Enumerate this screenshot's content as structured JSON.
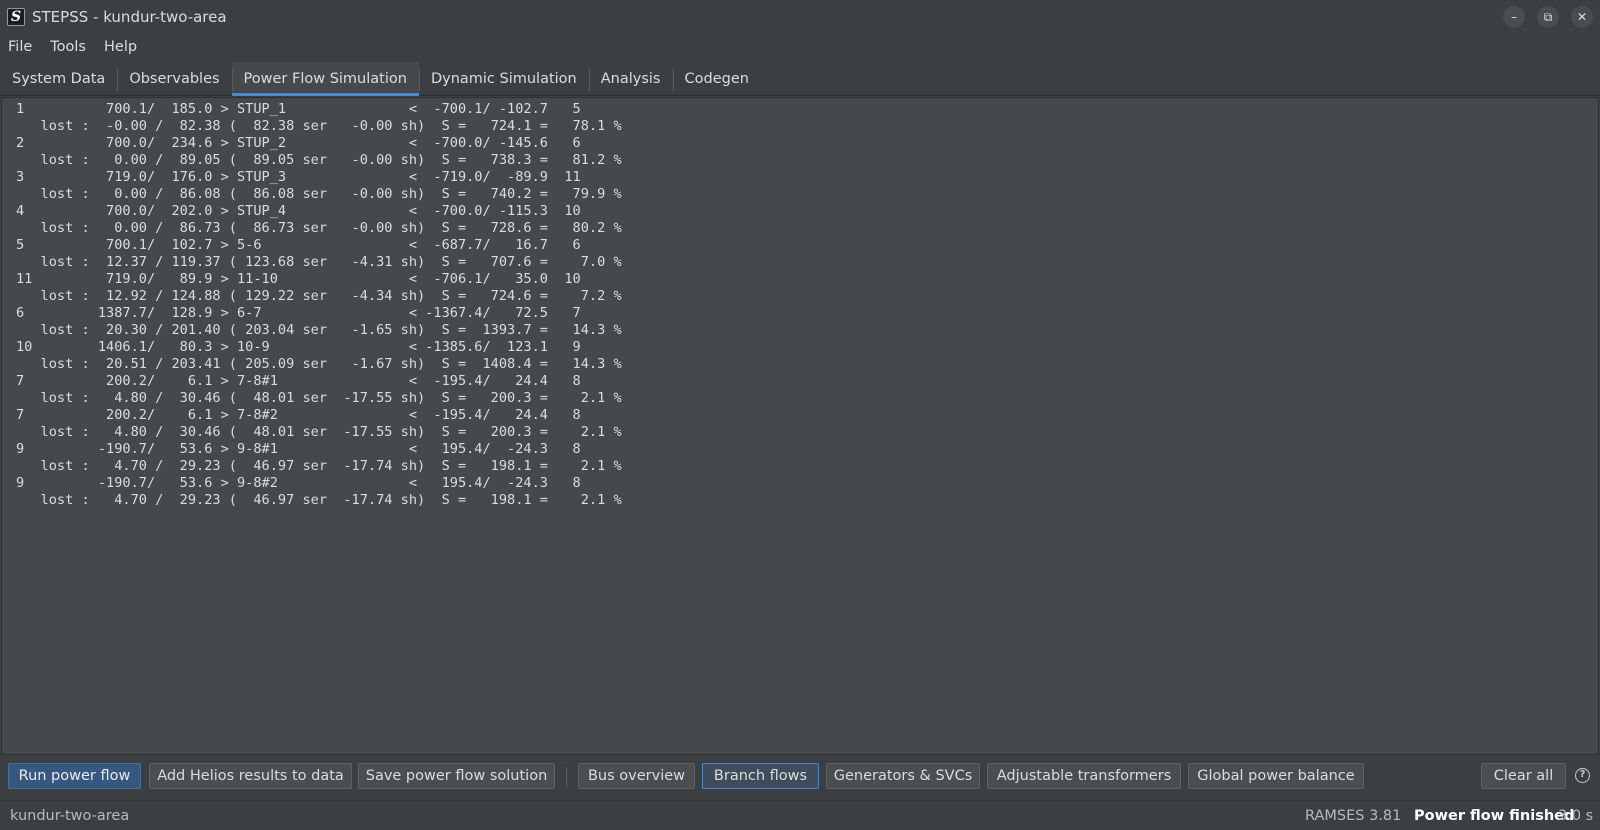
{
  "window": {
    "app_icon_letter": "S",
    "title": "STEPSS - kundur-two-area",
    "minimize_glyph": "–",
    "restore_glyph": "⧉",
    "close_glyph": "✕"
  },
  "menu": [
    "File",
    "Tools",
    "Help"
  ],
  "tabs": [
    {
      "label": "System Data",
      "active": false
    },
    {
      "label": "Observables",
      "active": false
    },
    {
      "label": "Power Flow Simulation",
      "active": true
    },
    {
      "label": "Dynamic Simulation",
      "active": false
    },
    {
      "label": "Analysis",
      "active": false
    },
    {
      "label": "Codegen",
      "active": false
    }
  ],
  "output_lines": [
    "1          700.1/  185.0 > STUP_1               <  -700.1/ -102.7   5",
    "   lost :  -0.00 /  82.38 (  82.38 ser   -0.00 sh)  S =   724.1 =   78.1 %",
    "2          700.0/  234.6 > STUP_2               <  -700.0/ -145.6   6",
    "   lost :   0.00 /  89.05 (  89.05 ser   -0.00 sh)  S =   738.3 =   81.2 %",
    "3          719.0/  176.0 > STUP_3               <  -719.0/  -89.9  11",
    "   lost :   0.00 /  86.08 (  86.08 ser   -0.00 sh)  S =   740.2 =   79.9 %",
    "4          700.0/  202.0 > STUP_4               <  -700.0/ -115.3  10",
    "   lost :   0.00 /  86.73 (  86.73 ser   -0.00 sh)  S =   728.6 =   80.2 %",
    "5          700.1/  102.7 > 5-6                  <  -687.7/   16.7   6",
    "   lost :  12.37 / 119.37 ( 123.68 ser   -4.31 sh)  S =   707.6 =    7.0 %",
    "11         719.0/   89.9 > 11-10                <  -706.1/   35.0  10",
    "   lost :  12.92 / 124.88 ( 129.22 ser   -4.34 sh)  S =   724.6 =    7.2 %",
    "6         1387.7/  128.9 > 6-7                  < -1367.4/   72.5   7",
    "   lost :  20.30 / 201.40 ( 203.04 ser   -1.65 sh)  S =  1393.7 =   14.3 %",
    "10        1406.1/   80.3 > 10-9                 < -1385.6/  123.1   9",
    "   lost :  20.51 / 203.41 ( 205.09 ser   -1.67 sh)  S =  1408.4 =   14.3 %",
    "7          200.2/    6.1 > 7-8#1                <  -195.4/   24.4   8",
    "   lost :   4.80 /  30.46 (  48.01 ser  -17.55 sh)  S =   200.3 =    2.1 %",
    "7          200.2/    6.1 > 7-8#2                <  -195.4/   24.4   8",
    "   lost :   4.80 /  30.46 (  48.01 ser  -17.55 sh)  S =   200.3 =    2.1 %",
    "9         -190.7/   53.6 > 9-8#1                <   195.4/  -24.3   8",
    "   lost :   4.70 /  29.23 (  46.97 ser  -17.74 sh)  S =   198.1 =    2.1 %",
    "9         -190.7/   53.6 > 9-8#2                <   195.4/  -24.3   8",
    "   lost :   4.70 /  29.23 (  46.97 ser  -17.74 sh)  S =   198.1 =    2.1 %"
  ],
  "buttons": {
    "run_power_flow": "Run power flow",
    "add_helios": "Add Helios results to data",
    "save_solution": "Save power flow solution",
    "bus_overview": "Bus overview",
    "branch_flows": "Branch flows",
    "generators_svcs": "Generators & SVCs",
    "adjustable_transformers": "Adjustable transformers",
    "global_power_balance": "Global power balance",
    "clear_all": "Clear all",
    "help_glyph": "?"
  },
  "status": {
    "project": "kundur-two-area",
    "version": "RAMSES 3.81",
    "message": "Power flow finished",
    "elapsed": "3.0 s"
  },
  "colors": {
    "background": "#3c3f41",
    "accent": "#4a88c7",
    "primary_button": "#365880"
  }
}
